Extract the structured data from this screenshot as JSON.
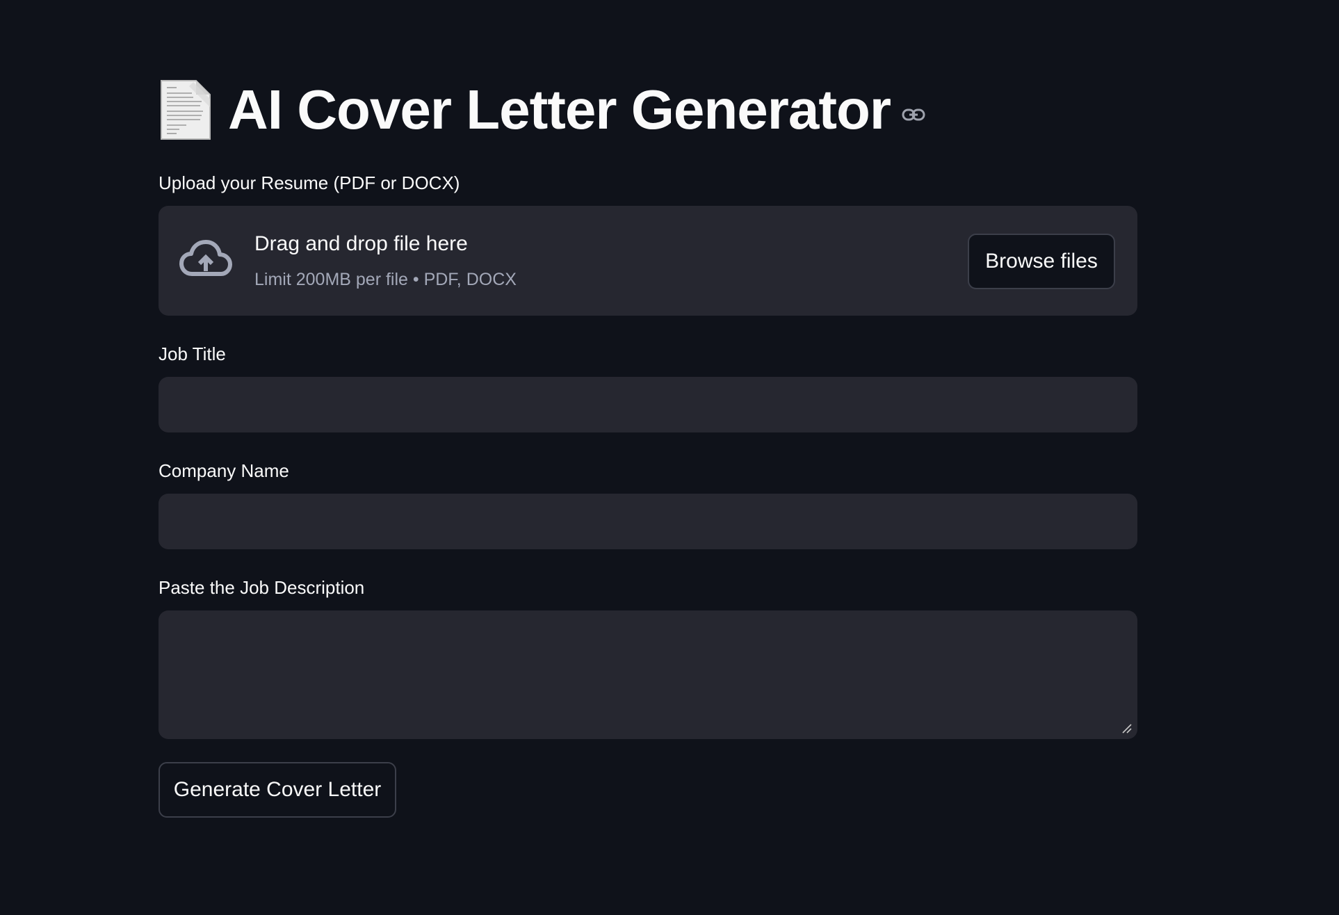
{
  "header": {
    "title": "AI Cover Letter Generator",
    "title_icon": "page-facing-up-icon",
    "anchor_icon": "link-icon"
  },
  "uploader": {
    "label": "Upload your Resume (PDF or DOCX)",
    "drop_title": "Drag and drop file here",
    "drop_limit": "Limit 200MB per file • PDF, DOCX",
    "browse_label": "Browse files",
    "icon": "cloud-upload-icon"
  },
  "job_title": {
    "label": "Job Title",
    "value": "",
    "placeholder": ""
  },
  "company_name": {
    "label": "Company Name",
    "value": "",
    "placeholder": ""
  },
  "job_description": {
    "label": "Paste the Job Description",
    "value": "",
    "placeholder": ""
  },
  "generate_button": {
    "label": "Generate Cover Letter"
  },
  "colors": {
    "background": "#0f121a",
    "input_background": "#262730",
    "text": "#fafafa",
    "muted_text": "#a3a8b8",
    "border": "#3c3f4a"
  }
}
